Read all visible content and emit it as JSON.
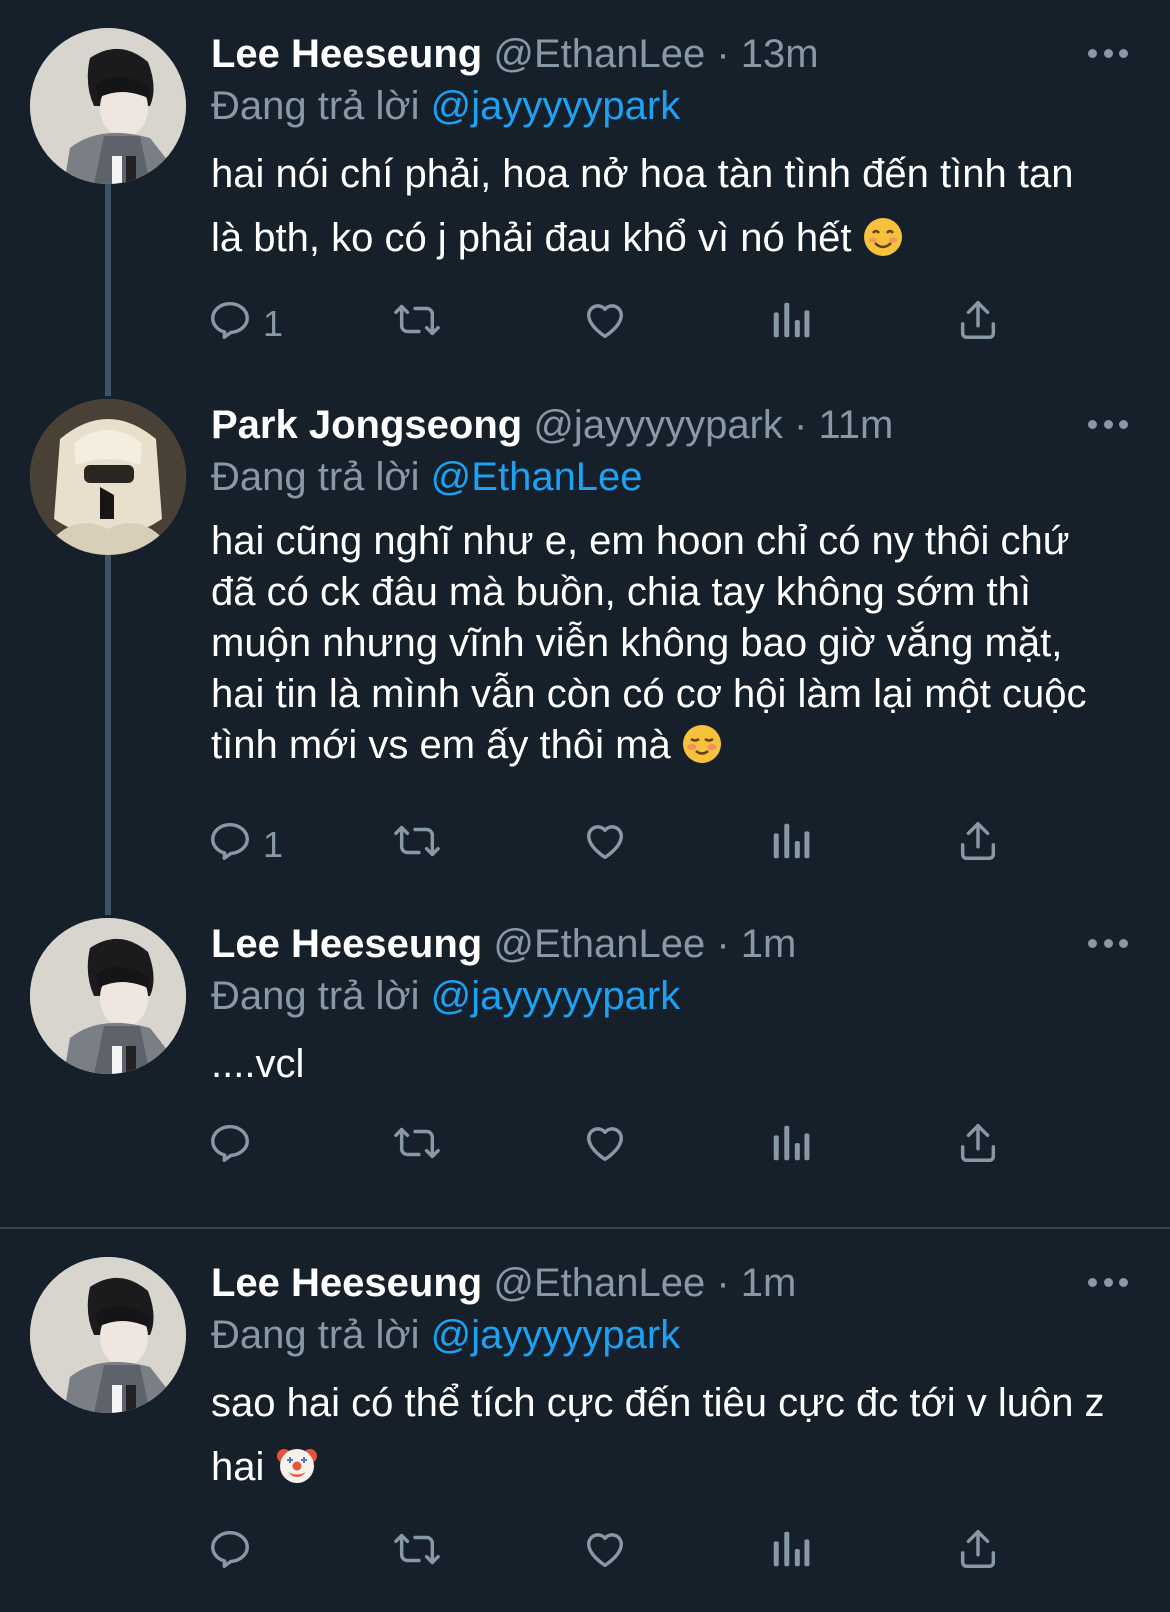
{
  "tweets": [
    {
      "name": "Lee Heeseung",
      "handle": "@EthanLee",
      "sep": "·",
      "time": "13m",
      "reply_prefix": "Đang trả lời",
      "reply_to": "@jayyyyypark",
      "text": "hai nói chí phải, hoa nở hoa tàn tình đến tình tan là bth, ko có j phải đau khổ vì nó hết",
      "emoji": "smiling-face-with-smiling-eyes",
      "reply_count": "1"
    },
    {
      "name": "Park Jongseong",
      "handle": "@jayyyyypark",
      "sep": "·",
      "time": "11m",
      "reply_prefix": "Đang trả lời",
      "reply_to": "@EthanLee",
      "text": "hai cũng nghĩ như e, em hoon chỉ có ny thôi chứ đã có ck đâu mà buồn, chia tay không sớm thì muộn nhưng vĩnh viễn không bao giờ vắng mặt, hai tin là mình vẫn còn có cơ hội làm lại một cuộc tình mới vs em ấy thôi mà",
      "emoji": "smiling-face",
      "reply_count": "1"
    },
    {
      "name": "Lee Heeseung",
      "handle": "@EthanLee",
      "sep": "·",
      "time": "1m",
      "reply_prefix": "Đang trả lời",
      "reply_to": "@jayyyyypark",
      "text": "....vcl",
      "emoji": "",
      "reply_count": ""
    },
    {
      "name": "Lee Heeseung",
      "handle": "@EthanLee",
      "sep": "·",
      "time": "1m",
      "reply_prefix": "Đang trả lời",
      "reply_to": "@jayyyyypark",
      "text": "sao hai có thể tích cực đến tiêu cực đc tới v luôn z hai",
      "emoji": "clown-face",
      "reply_count": ""
    }
  ],
  "icons": {
    "reply": "reply-icon",
    "retweet": "retweet-icon",
    "like": "heart-icon",
    "analytics": "analytics-icon",
    "share": "share-icon",
    "more": "more-icon"
  },
  "colors": {
    "background": "#15202b",
    "text": "#ffffff",
    "secondary": "#8899a6",
    "link": "#1da1f2",
    "thread_line": "#3d5466",
    "divider": "#38444d"
  }
}
